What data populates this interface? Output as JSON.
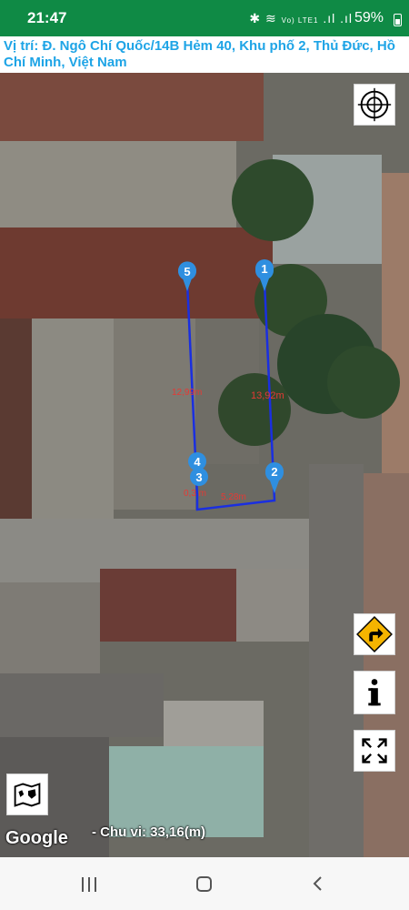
{
  "status_bar": {
    "time": "21:47",
    "icons": [
      "bluetooth-icon",
      "wifi-icon",
      "volte-icon",
      "signal-icon",
      "signal-icon"
    ],
    "network_label": "Vo) LTE1",
    "battery": "59%"
  },
  "location": {
    "text": "Vị trí: Đ. Ngô Chí Quốc/14B Hẻm 40, Khu phố 2, Thủ Đức, Hồ Chí Minh, Việt Nam"
  },
  "map": {
    "markers": [
      {
        "label": "1"
      },
      {
        "label": "2"
      },
      {
        "label": "3"
      },
      {
        "label": "4"
      },
      {
        "label": "5"
      }
    ],
    "segment_lengths": [
      "13,92m",
      "5,28m",
      "0,3 m",
      "12,99m"
    ],
    "line_color": "#1a2fe0",
    "marker_color": "#2f8fe0",
    "measure_text_color": "#e53935",
    "buttons": {
      "locate": "crosshair-icon",
      "directions": "turn-right-icon",
      "info": "info-icon",
      "fullscreen": "fullscreen-icon",
      "map_type": "map-icon"
    },
    "attribution": "Google",
    "perimeter_text": "- Chu vi: 33,16(m)"
  },
  "nav_bar": {
    "buttons": [
      "recent-apps-icon",
      "home-icon",
      "back-icon"
    ]
  },
  "colors": {
    "status_bar": "#0f8a45",
    "location_text": "#1ea4e6"
  }
}
